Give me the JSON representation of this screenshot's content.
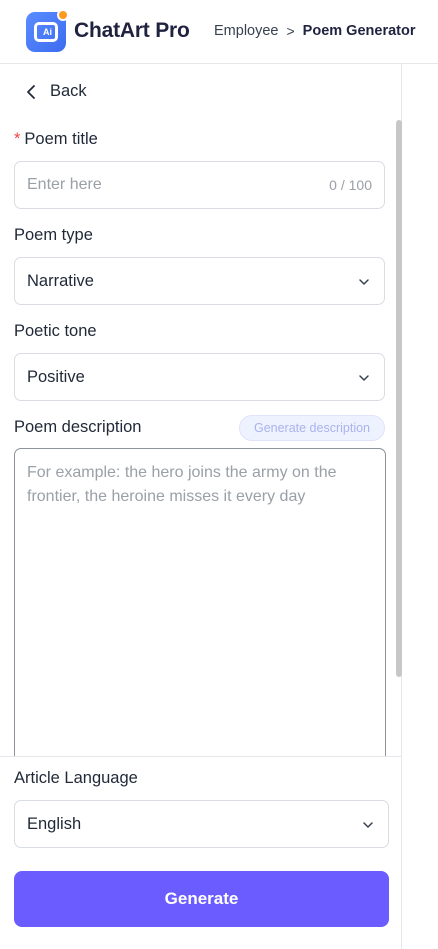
{
  "header": {
    "app_name": "ChatArt Pro",
    "logo_text": "Ai",
    "breadcrumb": [
      "Employee",
      "Poem Generator"
    ],
    "breadcrumb_separator": ">"
  },
  "nav": {
    "back_label": "Back"
  },
  "form": {
    "poem_title": {
      "label": "Poem title",
      "required_mark": "*",
      "placeholder": "Enter here",
      "counter": "0 / 100"
    },
    "poem_type": {
      "label": "Poem type",
      "value": "Narrative"
    },
    "poetic_tone": {
      "label": "Poetic tone",
      "value": "Positive"
    },
    "poem_description": {
      "label": "Poem description",
      "generate_label": "Generate description",
      "placeholder": "For example: the hero joins the army on the frontier, the heroine misses it every day"
    },
    "article_language": {
      "label": "Article Language",
      "value": "English"
    },
    "submit_label": "Generate"
  },
  "colors": {
    "accent": "#6a5cff",
    "required": "#ef4444",
    "logo": "#4a7cf6",
    "badge": "#ff9a1f"
  },
  "icons": [
    "back-chevron-icon",
    "chevron-down-icon",
    "logo-icon"
  ]
}
